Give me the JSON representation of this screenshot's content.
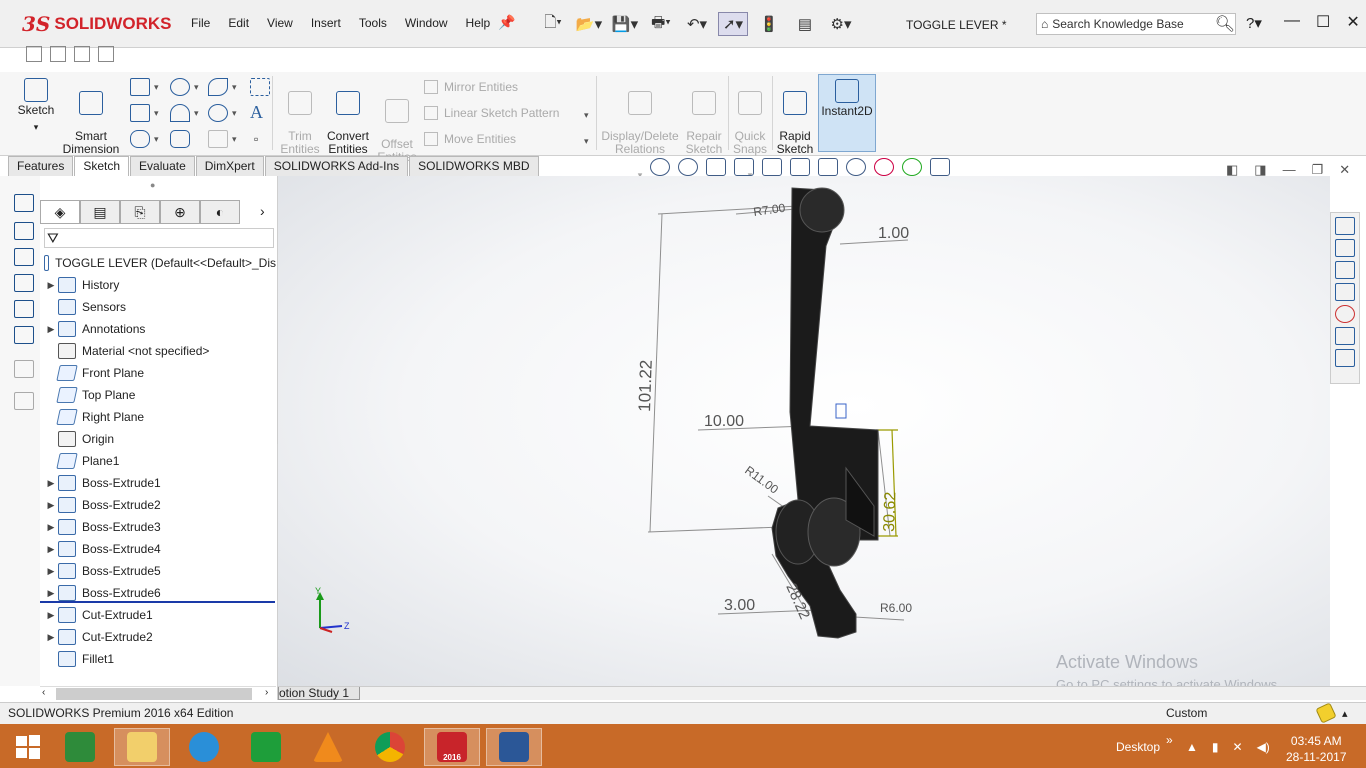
{
  "app": {
    "brand": "SOLIDWORKS",
    "brand_mark": "3S",
    "document_title": "TOGGLE LEVER *",
    "accent_color": "#d2232a"
  },
  "menu": [
    "File",
    "Edit",
    "View",
    "Insert",
    "Tools",
    "Window",
    "Help"
  ],
  "search": {
    "placeholder": "Search Knowledge Base"
  },
  "help_label": "?",
  "command_manager": {
    "sketch": "Sketch",
    "smart_dimension": "Smart\nDimension",
    "trim_entities": "Trim\nEntities",
    "convert_entities": "Convert\nEntities",
    "offset_entities": "Offset\nEntities",
    "mirror_entities": "Mirror Entities",
    "linear_sketch_pattern": "Linear Sketch Pattern",
    "move_entities": "Move Entities",
    "display_delete_relations": "Display/Delete\nRelations",
    "repair_sketch": "Repair\nSketch",
    "quick_snaps": "Quick\nSnaps",
    "rapid_sketch": "Rapid\nSketch",
    "instant2d": "Instant2D"
  },
  "tabs": [
    {
      "label": "Features",
      "active": false
    },
    {
      "label": "Sketch",
      "active": true
    },
    {
      "label": "Evaluate",
      "active": false
    },
    {
      "label": "DimXpert",
      "active": false
    },
    {
      "label": "SOLIDWORKS Add-Ins",
      "active": false
    },
    {
      "label": "SOLIDWORKS MBD",
      "active": false
    }
  ],
  "feature_tree": {
    "root": "TOGGLE LEVER  (Default<<Default>_Dis",
    "items": [
      {
        "label": "History",
        "expandable": true,
        "icon": "history-icon"
      },
      {
        "label": "Sensors",
        "expandable": false,
        "icon": "sensors-icon"
      },
      {
        "label": "Annotations",
        "expandable": true,
        "icon": "annotations-icon"
      },
      {
        "label": "Material <not specified>",
        "expandable": false,
        "icon": "material-icon"
      },
      {
        "label": "Front Plane",
        "expandable": false,
        "icon": "plane-icon"
      },
      {
        "label": "Top Plane",
        "expandable": false,
        "icon": "plane-icon"
      },
      {
        "label": "Right Plane",
        "expandable": false,
        "icon": "plane-icon"
      },
      {
        "label": "Origin",
        "expandable": false,
        "icon": "origin-icon"
      },
      {
        "label": "Plane1",
        "expandable": false,
        "icon": "plane-icon"
      },
      {
        "label": "Boss-Extrude1",
        "expandable": true,
        "icon": "boss-extrude-icon"
      },
      {
        "label": "Boss-Extrude2",
        "expandable": true,
        "icon": "boss-extrude-icon"
      },
      {
        "label": "Boss-Extrude3",
        "expandable": true,
        "icon": "boss-extrude-icon"
      },
      {
        "label": "Boss-Extrude4",
        "expandable": true,
        "icon": "boss-extrude-icon"
      },
      {
        "label": "Boss-Extrude5",
        "expandable": true,
        "icon": "boss-extrude-icon"
      },
      {
        "label": "Boss-Extrude6",
        "expandable": true,
        "icon": "boss-extrude-icon"
      },
      {
        "label": "Cut-Extrude1",
        "expandable": true,
        "icon": "cut-extrude-icon"
      },
      {
        "label": "Cut-Extrude2",
        "expandable": true,
        "icon": "cut-extrude-icon"
      },
      {
        "label": "Fillet1",
        "expandable": false,
        "icon": "fillet-icon"
      }
    ]
  },
  "dimensions": {
    "r7": "R7.00",
    "d1": "1.00",
    "d101": "101.22",
    "d10": "10.00",
    "r11": "R11.00",
    "d30": "30.62",
    "d3": "3.00",
    "d28": "28.22",
    "r6": "R6.00",
    "highlight_color": "#8a8a00"
  },
  "triad": {
    "y": "Y",
    "z": "Z"
  },
  "bottom_tab": "otion Study 1",
  "activate": {
    "title": "Activate Windows",
    "subtitle": "Go to PC settings to activate Windows."
  },
  "status": {
    "edition": "SOLIDWORKS Premium 2016 x64 Edition",
    "units": "Custom"
  },
  "taskbar": {
    "color": "#c86a28",
    "desktop": "Desktop",
    "time": "03:45 AM",
    "date": "28-11-2017",
    "sw_badge": "2016"
  }
}
